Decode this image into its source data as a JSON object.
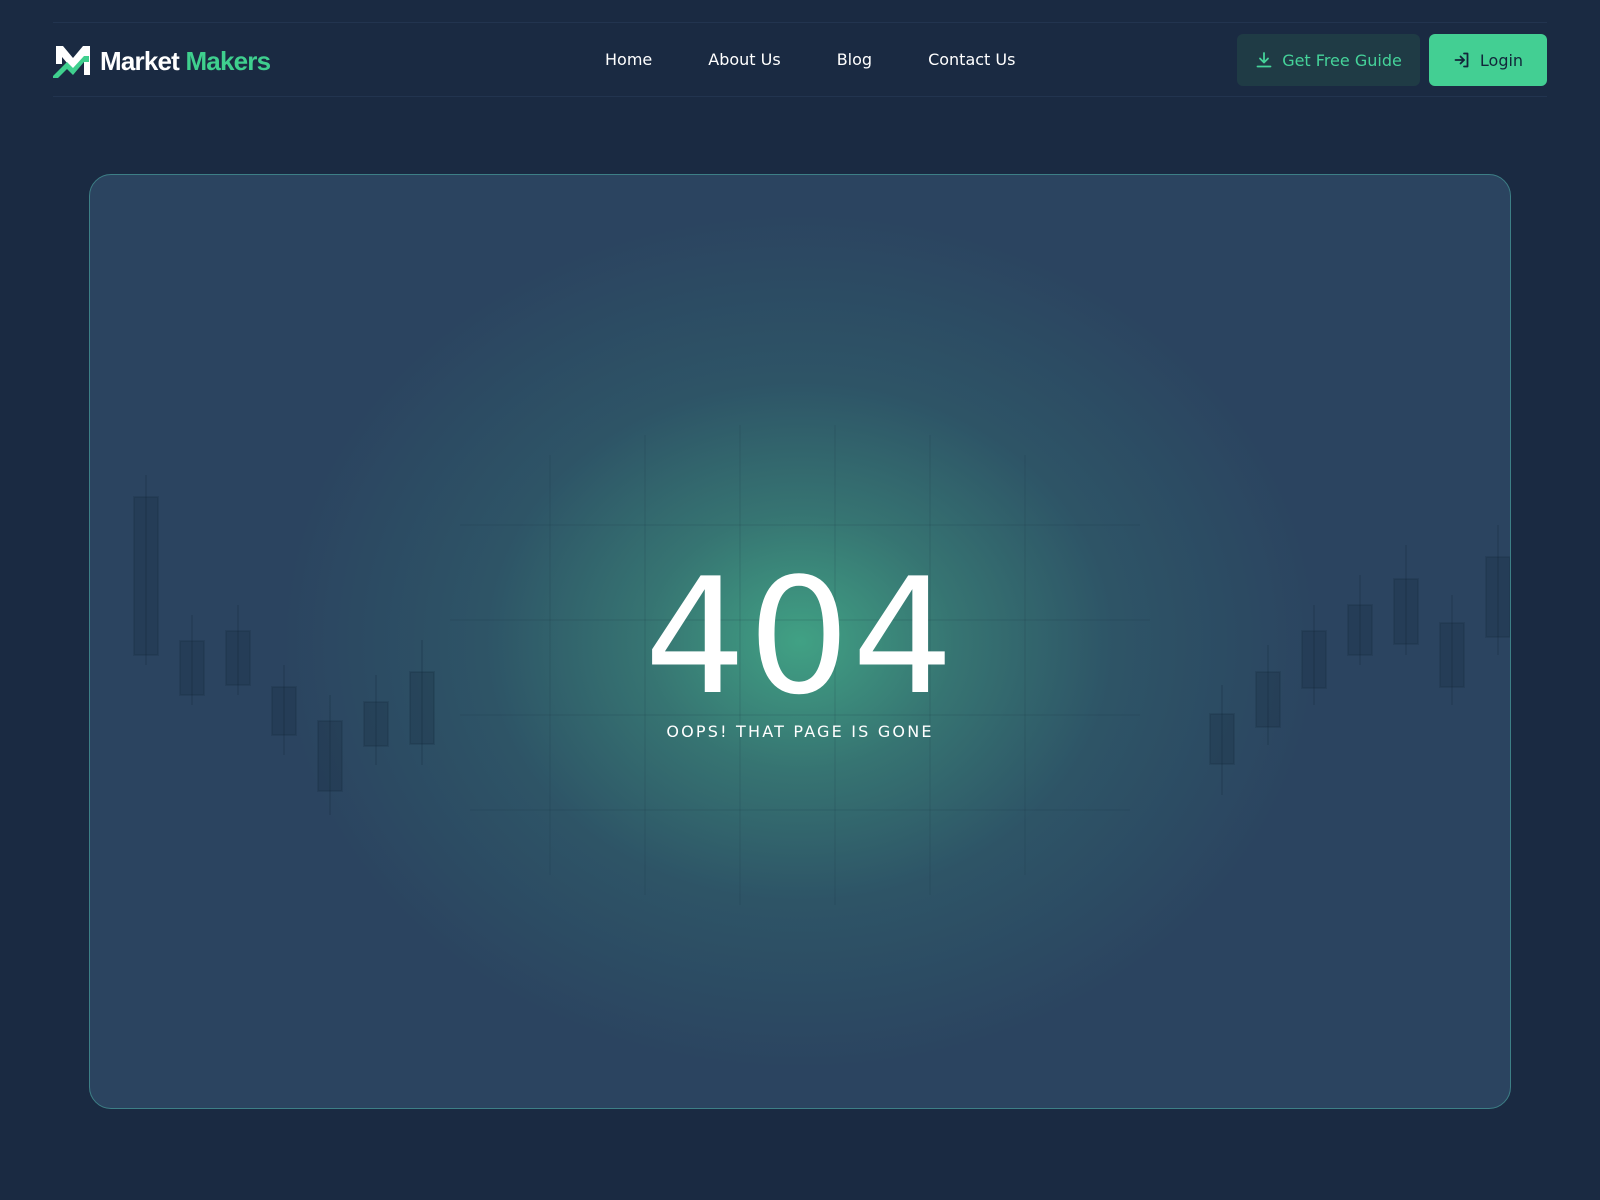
{
  "brand": {
    "name_part1": "Market",
    "name_part2": "Makers",
    "logo_icon": "m-chart-logo-icon",
    "accent_color": "#3fcf8e"
  },
  "nav": {
    "items": [
      {
        "label": "Home"
      },
      {
        "label": "About Us"
      },
      {
        "label": "Blog"
      },
      {
        "label": "Contact Us"
      }
    ]
  },
  "actions": {
    "guide": {
      "label": "Get Free Guide",
      "icon": "download-icon"
    },
    "login": {
      "label": "Login",
      "icon": "login-icon"
    }
  },
  "error": {
    "code": "404",
    "message": "OOPS! THAT PAGE IS GONE",
    "background_decoration": "candlestick-chart-pattern"
  },
  "colors": {
    "page_bg": "#1a2a42",
    "card_bg": "#2b4460",
    "guide_button_bg": "#1f3b45",
    "login_button_bg": "#43cf93"
  }
}
